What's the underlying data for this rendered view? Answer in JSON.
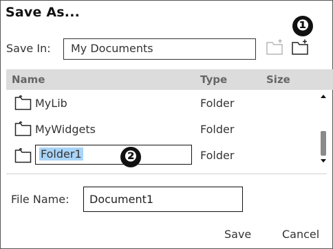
{
  "dialog": {
    "title": "Save As...",
    "callouts": [
      "❶",
      "❷"
    ]
  },
  "save_in": {
    "label": "Save In:",
    "value": "My Documents"
  },
  "toolbar": {
    "up_folder_icon": "up-folder-icon",
    "new_folder_icon": "new-folder-icon"
  },
  "list": {
    "headers": {
      "name": "Name",
      "type": "Type",
      "size": "Size"
    },
    "rows": [
      {
        "name": "MyLib",
        "type": "Folder",
        "icon": "folder-icon"
      },
      {
        "name": "MyWidgets",
        "type": "Folder",
        "icon": "folder-icon"
      },
      {
        "name": "Folder1",
        "type": "Folder",
        "icon": "folder-icon",
        "editing": true
      }
    ]
  },
  "file_name": {
    "label": "File Name:",
    "value": "Document1"
  },
  "buttons": {
    "save": "Save",
    "cancel": "Cancel"
  },
  "colors": {
    "selection_highlight": "#a9d4f7",
    "header_background": "#dcdcdc",
    "callout": "#111111"
  }
}
